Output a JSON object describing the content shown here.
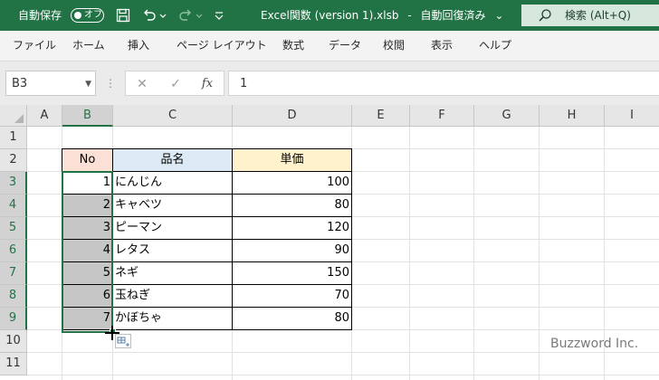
{
  "titlebar": {
    "autosave_label": "自動保存",
    "autosave_state": "オフ",
    "file_title": "Excel関数 (version 1).xlsb",
    "separator": "-",
    "save_status": "自動回復済み",
    "status_chevron": "⌄",
    "more_chevron": "⌄",
    "search_text": "検索 (Alt+Q)",
    "accent_color": "#217346"
  },
  "menu": {
    "items": [
      "ファイル",
      "ホーム",
      "挿入",
      "ページ レイアウト",
      "数式",
      "データ",
      "校閲",
      "表示",
      "ヘルプ"
    ]
  },
  "formula_bar": {
    "name_box": "B3",
    "name_arrow": "▼",
    "dots": "⋮",
    "cancel": "✕",
    "enter": "✓",
    "fx": "fx",
    "value": "1"
  },
  "sheet": {
    "columns": [
      "A",
      "B",
      "C",
      "D",
      "E",
      "F",
      "G",
      "H",
      "I"
    ],
    "rows": [
      "1",
      "2",
      "3",
      "4",
      "5",
      "6",
      "7",
      "8",
      "9",
      "10",
      "11"
    ],
    "selected_column": "B",
    "selected_rows": [
      "3",
      "4",
      "5",
      "6",
      "7",
      "8",
      "9"
    ]
  },
  "table": {
    "headers": {
      "no": "No",
      "name": "品名",
      "price": "単価"
    },
    "rows": [
      {
        "no": "1",
        "name": "にんじん",
        "price": "100"
      },
      {
        "no": "2",
        "name": "キャベツ",
        "price": "80"
      },
      {
        "no": "3",
        "name": "ピーマン",
        "price": "120"
      },
      {
        "no": "4",
        "name": "レタス",
        "price": "90"
      },
      {
        "no": "5",
        "name": "ネギ",
        "price": "150"
      },
      {
        "no": "6",
        "name": "玉ねぎ",
        "price": "70"
      },
      {
        "no": "7",
        "name": "かぼちゃ",
        "price": "80"
      }
    ],
    "header_colors": {
      "no": "#fbe0d6",
      "name": "#ddeaf6",
      "price": "#fff2cc"
    }
  },
  "watermark": "Buzzword Inc."
}
